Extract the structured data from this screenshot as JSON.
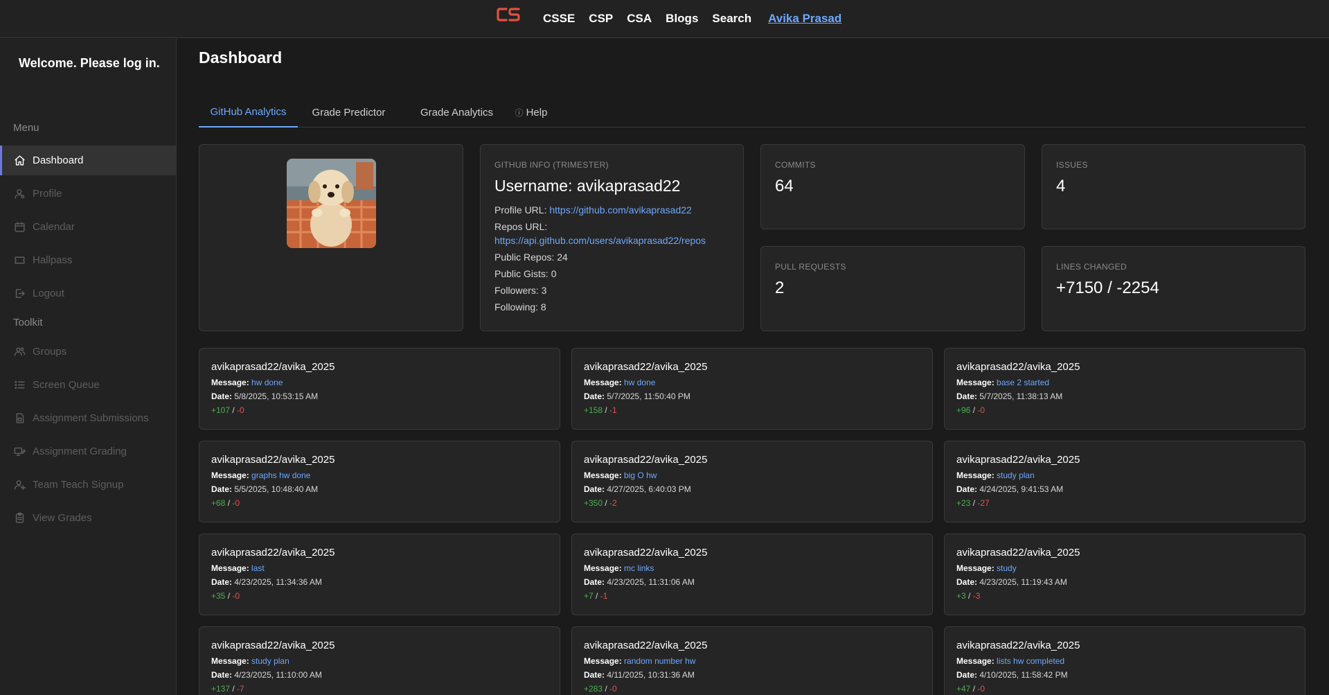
{
  "nav": {
    "links": [
      "CSSE",
      "CSP",
      "CSA",
      "Blogs",
      "Search"
    ],
    "user": "Avika Prasad",
    "logo_color": "#e3513f"
  },
  "sidebar": {
    "welcome": "Welcome. Please log in.",
    "menu_label": "Menu",
    "toolkit_label": "Toolkit",
    "menu_items": [
      {
        "label": "Dashboard",
        "icon": "home-icon",
        "active": true
      },
      {
        "label": "Profile",
        "icon": "user-icon"
      },
      {
        "label": "Calendar",
        "icon": "calendar-icon"
      },
      {
        "label": "Hallpass",
        "icon": "ticket-icon"
      },
      {
        "label": "Logout",
        "icon": "logout-icon"
      }
    ],
    "toolkit_items": [
      {
        "label": "Groups",
        "icon": "users-icon"
      },
      {
        "label": "Screen Queue",
        "icon": "list-icon"
      },
      {
        "label": "Assignment Submissions",
        "icon": "submission-icon"
      },
      {
        "label": "Assignment Grading",
        "icon": "grading-icon"
      },
      {
        "label": "Team Teach Signup",
        "icon": "user-plus-icon"
      },
      {
        "label": "View Grades",
        "icon": "clipboard-icon"
      }
    ]
  },
  "main": {
    "title": "Dashboard",
    "tabs": [
      {
        "label": "GitHub Analytics",
        "active": true
      },
      {
        "label": "Grade Predictor"
      },
      {
        "label": "Grade Analytics"
      },
      {
        "label": "Help",
        "icon": "info-icon"
      }
    ],
    "github_info": {
      "label": "GITHUB INFO (TRIMESTER)",
      "username": "Username: avikaprasad22",
      "profile_url_label": "Profile URL:",
      "profile_url": "https://github.com/avikaprasad22",
      "repos_url_label": "Repos URL:",
      "repos_url": "https://api.github.com/users/avikaprasad22/repos",
      "public_repos": "Public Repos: 24",
      "public_gists": "Public Gists: 0",
      "followers": "Followers: 3",
      "following": "Following: 8"
    },
    "stats": [
      {
        "label": "COMMITS",
        "value": "64"
      },
      {
        "label": "ISSUES",
        "value": "4"
      },
      {
        "label": "PULL REQUESTS",
        "value": "2"
      },
      {
        "label": "LINES CHANGED",
        "value": "+7150 / -2254"
      }
    ],
    "commit_labels": {
      "message": "Message:",
      "date": "Date:"
    },
    "commits": [
      {
        "repo": "avikaprasad22/avika_2025",
        "message": "hw done",
        "date": "5/8/2025, 10:53:15 AM",
        "add": "+107",
        "del": "-0"
      },
      {
        "repo": "avikaprasad22/avika_2025",
        "message": "hw done",
        "date": "5/7/2025, 11:50:40 PM",
        "add": "+158",
        "del": "-1"
      },
      {
        "repo": "avikaprasad22/avika_2025",
        "message": "base 2 started",
        "date": "5/7/2025, 11:38:13 AM",
        "add": "+96",
        "del": "-0"
      },
      {
        "repo": "avikaprasad22/avika_2025",
        "message": "graphs hw done",
        "date": "5/5/2025, 10:48:40 AM",
        "add": "+68",
        "del": "-0"
      },
      {
        "repo": "avikaprasad22/avika_2025",
        "message": "big O hw",
        "date": "4/27/2025, 6:40:03 PM",
        "add": "+350",
        "del": "-2"
      },
      {
        "repo": "avikaprasad22/avika_2025",
        "message": "study plan",
        "date": "4/24/2025, 9:41:53 AM",
        "add": "+23",
        "del": "-27"
      },
      {
        "repo": "avikaprasad22/avika_2025",
        "message": "last",
        "date": "4/23/2025, 11:34:36 AM",
        "add": "+35",
        "del": "-0"
      },
      {
        "repo": "avikaprasad22/avika_2025",
        "message": "mc links",
        "date": "4/23/2025, 11:31:06 AM",
        "add": "+7",
        "del": "-1"
      },
      {
        "repo": "avikaprasad22/avika_2025",
        "message": "study",
        "date": "4/23/2025, 11:19:43 AM",
        "add": "+3",
        "del": "-3"
      },
      {
        "repo": "avikaprasad22/avika_2025",
        "message": "study plan",
        "date": "4/23/2025, 11:10:00 AM",
        "add": "+137",
        "del": "-7"
      },
      {
        "repo": "avikaprasad22/avika_2025",
        "message": "random number hw",
        "date": "4/11/2025, 10:31:36 AM",
        "add": "+283",
        "del": "-0"
      },
      {
        "repo": "avikaprasad22/avika_2025",
        "message": "lists hw completed",
        "date": "4/10/2025, 11:58:42 PM",
        "add": "+47",
        "del": "-0"
      }
    ],
    "colors": {
      "accent": "#6ea8fe",
      "added": "#4caf50",
      "deleted": "#e05252"
    }
  }
}
